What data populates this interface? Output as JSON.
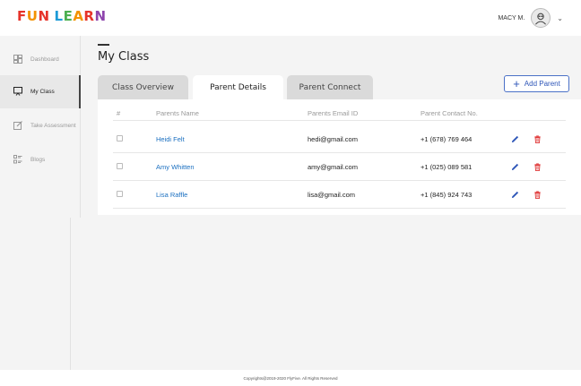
{
  "logo": {
    "letters": [
      "F",
      "U",
      "N",
      " ",
      "L",
      "E",
      "A",
      "R",
      "N"
    ],
    "colors": [
      "#e6332a",
      "#f39200",
      "#e6332a",
      "#ffffff",
      "#1d9bd7",
      "#4caf50",
      "#f39200",
      "#e6332a",
      "#8e44ad"
    ]
  },
  "user": {
    "name": "MACY M."
  },
  "sidebar": {
    "items": [
      {
        "label": "Dashboard",
        "icon": "dashboard-icon"
      },
      {
        "label": "My Class",
        "icon": "monitor-icon",
        "active": true
      },
      {
        "label": "Take Assessment",
        "icon": "edit-icon"
      },
      {
        "label": "Blogs",
        "icon": "list-icon"
      }
    ]
  },
  "page": {
    "title": "My Class"
  },
  "tabs": [
    {
      "label": "Class Overview"
    },
    {
      "label": "Parent Details",
      "active": true
    },
    {
      "label": "Parent Connect"
    }
  ],
  "add_button": {
    "label": "Add Parent"
  },
  "table": {
    "headers": [
      "#",
      "Parents Name",
      "Parents Email ID",
      "Parent Contact No."
    ],
    "rows": [
      {
        "name": "Heidi Felt",
        "email": "hedi@gmail.com",
        "phone": "+1 (678) 769 464"
      },
      {
        "name": "Amy Whitten",
        "email": "amy@gmail.com",
        "phone": "+1 (025) 089 581"
      },
      {
        "name": "Lisa Raffle",
        "email": "lisa@gmail.com",
        "phone": "+1 (845) 924 743"
      }
    ]
  },
  "colors": {
    "accent": "#2e56b8",
    "link": "#1a6fc0",
    "delete": "#e03a3a"
  },
  "footer": {
    "text": "Copyrights@2019-2020 FlyFive. All Rights Reserved"
  }
}
